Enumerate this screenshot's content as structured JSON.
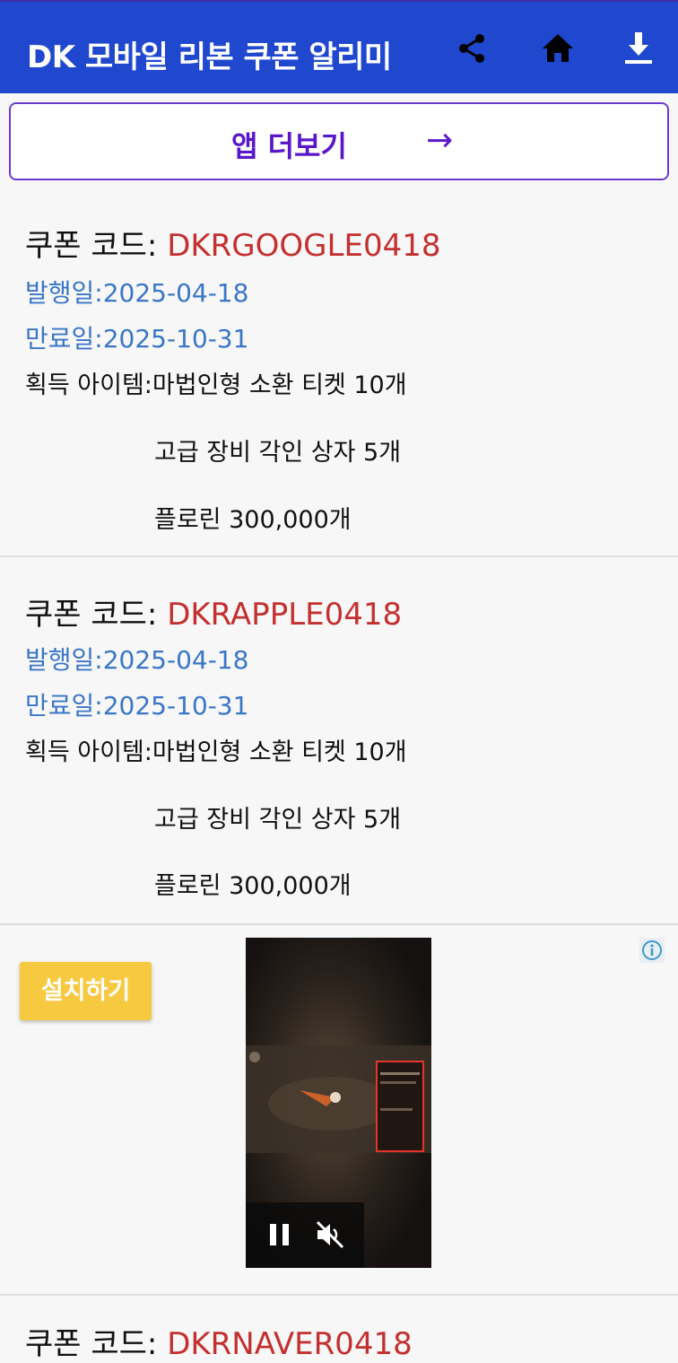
{
  "appbar": {
    "title": "DK 모바일 리본 쿠폰 알리미",
    "icons": [
      "share-icon",
      "home-icon",
      "download-icon"
    ]
  },
  "more_button": {
    "label": "앱 더보기",
    "arrow": "→"
  },
  "coupon_label": "쿠폰 코드: ",
  "items_label": "획득 아이템:",
  "coupons": [
    {
      "code": "DKRGOOGLE0418",
      "issued": "발행일:2025-04-18",
      "expires": "만료일:2025-10-31",
      "items": [
        "마법인형 소환 티켓 10개",
        "고급 장비 각인 상자 5개",
        "플로린 300,000개"
      ]
    },
    {
      "code": "DKRAPPLE0418",
      "issued": "발행일:2025-04-18",
      "expires": "만료일:2025-10-31",
      "items": [
        "마법인형 소환 티켓 10개",
        "고급 장비 각인 상자 5개",
        "플로린 300,000개"
      ]
    },
    {
      "code": "DKRNAVER0418"
    }
  ],
  "ad": {
    "install_label": "설치하기",
    "icons": [
      "info-icon",
      "pause-icon",
      "mute-icon"
    ]
  },
  "colors": {
    "appbar": "#1f48cf",
    "accent_purple": "#5a17c9",
    "code_red": "#c43030",
    "date_blue": "#3a76c7",
    "install_yellow": "#f6c940"
  }
}
